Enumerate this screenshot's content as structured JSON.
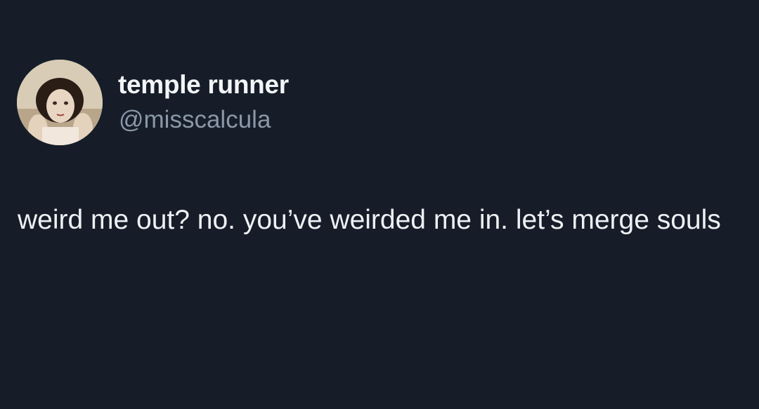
{
  "tweet": {
    "author": {
      "display_name": "temple runner",
      "handle": "@misscalcula",
      "avatar_icon": "profile-photo"
    },
    "text": "weird me out? no. you’ve weirded me in. let’s merge souls"
  },
  "colors": {
    "background": "#161d29",
    "primary_text": "#eef1f4",
    "secondary_text": "#8a97a6"
  }
}
